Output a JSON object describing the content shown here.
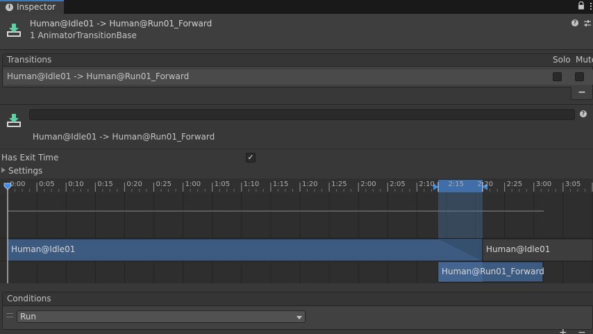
{
  "tab": {
    "title": "Inspector",
    "icon": "info-icon"
  },
  "header": {
    "title": "Human@Idle01 -> Human@Run01_Forward",
    "subtitle": "1 AnimatorTransitionBase"
  },
  "transitions": {
    "label": "Transitions",
    "solo_label": "Solo",
    "mute_label": "Mute",
    "rows": [
      {
        "name": "Human@Idle01 -> Human@Run01_Forward",
        "solo": false,
        "mute": false
      }
    ],
    "remove_label": "−"
  },
  "detail": {
    "name_value": "",
    "transition_name": "Human@Idle01 -> Human@Run01_Forward",
    "has_exit_time_label": "Has Exit Time",
    "has_exit_time": true,
    "has_exit_time_mark": "✓",
    "settings_label": "Settings"
  },
  "timeline": {
    "ticks": [
      "0:00",
      "0:05",
      "0:10",
      "0:15",
      "0:20",
      "0:25",
      "1:00",
      "1:05",
      "1:10",
      "1:15",
      "1:20",
      "1:25",
      "2:00",
      "2:05",
      "2:10",
      "2:15",
      "2:20",
      "2:25",
      "3:00",
      "3:05"
    ],
    "source_clip": "Human@Idle01",
    "source_clip_repeat": "Human@Idle01",
    "destination_clip": "Human@Run01_Forward",
    "colors": {
      "clip": "#3d5a80",
      "clip_dark": "#2f4562",
      "transition": "#3e6697",
      "gray_clip": "#3d3d3d"
    }
  },
  "conditions": {
    "label": "Conditions",
    "items": [
      {
        "parameter": "Run"
      }
    ],
    "add_label": "+",
    "remove_label": "−"
  }
}
